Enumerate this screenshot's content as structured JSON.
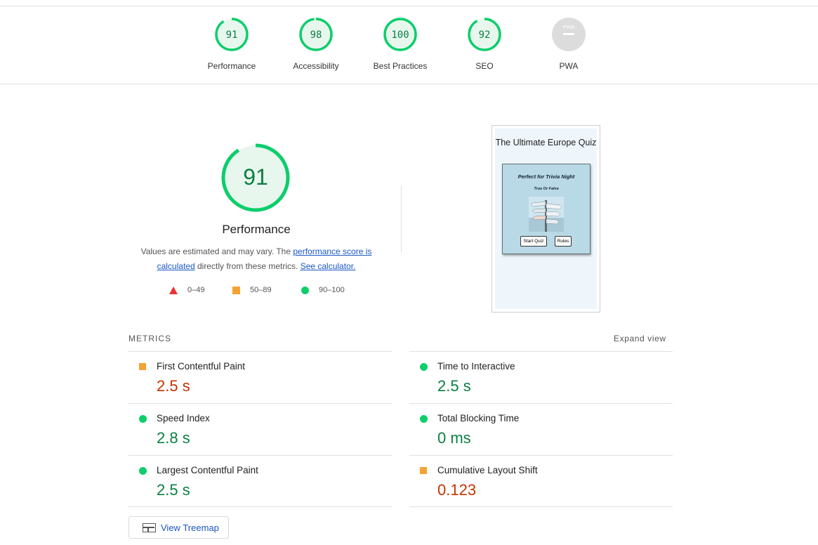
{
  "categories": [
    {
      "label": "Performance",
      "score": "91",
      "value": 0.91,
      "status": "pass"
    },
    {
      "label": "Accessibility",
      "score": "98",
      "value": 0.98,
      "status": "pass"
    },
    {
      "label": "Best Practices",
      "score": "100",
      "value": 1.0,
      "status": "pass"
    },
    {
      "label": "SEO",
      "score": "92",
      "value": 0.92,
      "status": "pass"
    },
    {
      "label": "PWA",
      "score": "PWA",
      "value": null,
      "status": "na"
    }
  ],
  "performance": {
    "score": "91",
    "value": 0.91,
    "title": "Performance",
    "desc_prefix": "Values are estimated and may vary. The ",
    "score_link": "performance score is calculated",
    "desc_middle": " directly from these metrics. ",
    "calc_link": "See calculator."
  },
  "legend": {
    "fail": "0–49",
    "average": "50–89",
    "pass": "90–100"
  },
  "screenshot": {
    "title": "The Ultimate Europe Quiz",
    "card_heading": "Perfect for Trivia Night",
    "card_subheading": "True Or False",
    "start_button": "Start Quiz",
    "rules_button": "Rules"
  },
  "metrics": {
    "heading": "METRICS",
    "expand_label": "Expand view",
    "items": [
      {
        "name": "First Contentful Paint",
        "value": "2.5 s",
        "status": "average"
      },
      {
        "name": "Time to Interactive",
        "value": "2.5 s",
        "status": "pass"
      },
      {
        "name": "Speed Index",
        "value": "2.8 s",
        "status": "pass"
      },
      {
        "name": "Total Blocking Time",
        "value": "0 ms",
        "status": "pass"
      },
      {
        "name": "Largest Contentful Paint",
        "value": "2.5 s",
        "status": "pass"
      },
      {
        "name": "Cumulative Layout Shift",
        "value": "0.123",
        "status": "average"
      }
    ]
  },
  "treemap_label": "View Treemap",
  "colors": {
    "pass": "#0cce6b",
    "pass_text": "#0b8043",
    "pass_fill": "#e8f7ee",
    "average": "#f6a233",
    "average_text": "#c33300",
    "fail": "#e5332f",
    "link": "#1a56c4",
    "na": "#e0e0e0"
  }
}
